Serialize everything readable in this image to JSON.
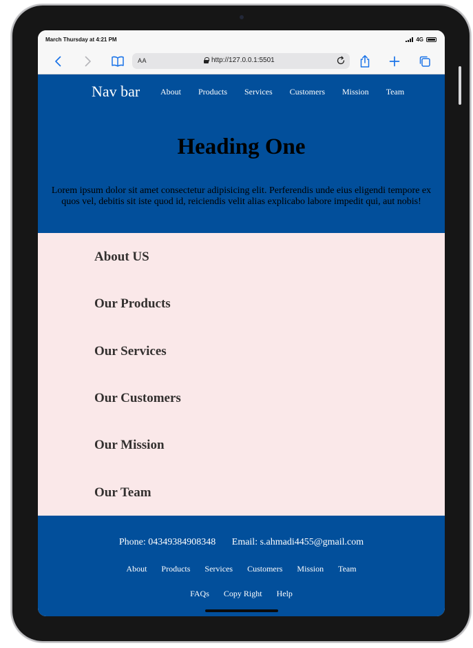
{
  "status_bar": {
    "time": "March Thursday at 4:21 PM",
    "network": "4G"
  },
  "toolbar": {
    "reader_label": "AA",
    "url": "http://127.0.0.1:5501"
  },
  "navbar": {
    "brand": "Nav bar",
    "links": [
      "About",
      "Products",
      "Services",
      "Customers",
      "Mission",
      "Team"
    ]
  },
  "hero": {
    "heading": "Heading One",
    "text": "Lorem ipsum dolor sit amet consectetur adipisicing elit. Perferendis unde eius eligendi tempore ex quos vel, debitis sit iste quod id, reiciendis velit alias explicabo labore impedit qui, aut nobis!"
  },
  "sections": [
    "About US",
    "Our Products",
    "Our Services",
    "Our Customers",
    "Our Mission",
    "Our Team"
  ],
  "footer": {
    "phone": "Phone: 04349384908348",
    "email": "Email: s.ahmadi4455@gmail.com",
    "links": [
      "About",
      "Products",
      "Services",
      "Customers",
      "Mission",
      "Team"
    ],
    "secondary_links": [
      "FAQs",
      "Copy Right",
      "Help"
    ]
  },
  "colors": {
    "primary_blue": "#024f9b",
    "section_bg": "#fae8e9",
    "ios_blue": "#1a73e8"
  }
}
